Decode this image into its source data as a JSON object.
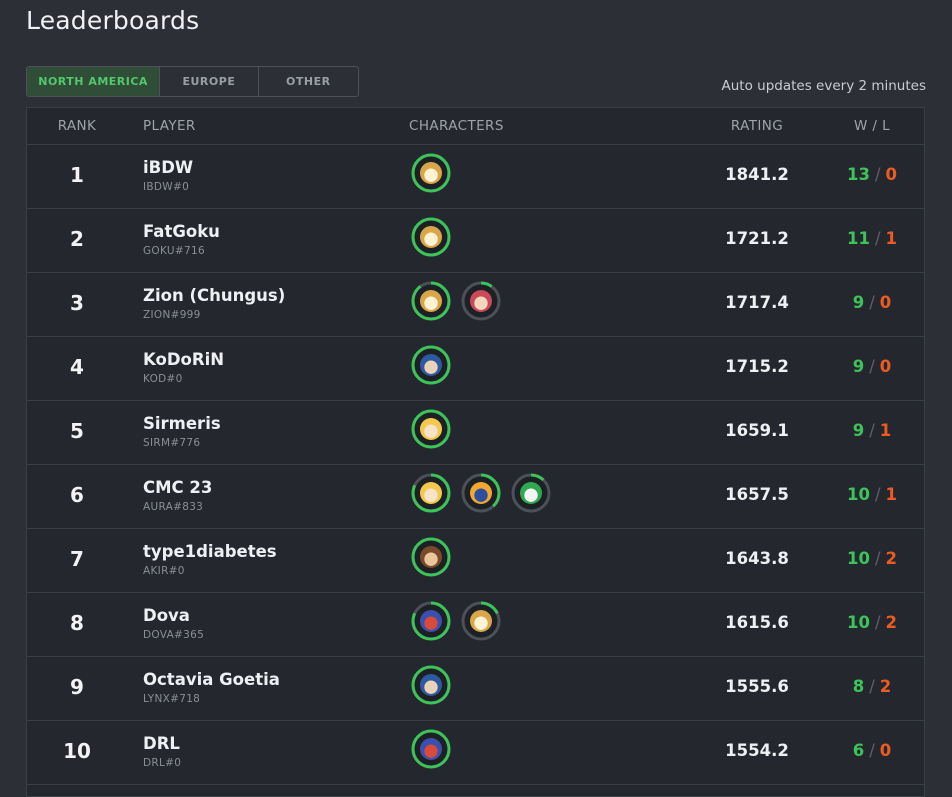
{
  "page": {
    "title": "Leaderboards",
    "auto_update": "Auto updates every 2 minutes"
  },
  "tabs": [
    {
      "label": "NORTH AMERICA",
      "active": true
    },
    {
      "label": "EUROPE",
      "active": false
    },
    {
      "label": "OTHER",
      "active": false
    }
  ],
  "columns": {
    "rank": "RANK",
    "player": "PLAYER",
    "characters": "CHARACTERS",
    "rating": "RATING",
    "wl": "W / L"
  },
  "colors": {
    "win": "#3cc45a",
    "loss": "#ec5b22",
    "accent": "#53c76d"
  },
  "rows": [
    {
      "rank": "1",
      "name": "iBDW",
      "tag": "IBDW#0",
      "rating": "1841.2",
      "wins": "13",
      "losses": "0",
      "characters": [
        {
          "icon": "fox-icon",
          "usage": 1.0
        }
      ]
    },
    {
      "rank": "2",
      "name": "FatGoku",
      "tag": "GOKU#716",
      "rating": "1721.2",
      "wins": "11",
      "losses": "1",
      "characters": [
        {
          "icon": "fox-icon",
          "usage": 1.0
        }
      ]
    },
    {
      "rank": "3",
      "name": "Zion (Chungus)",
      "tag": "ZION#999",
      "rating": "1717.4",
      "wins": "9",
      "losses": "0",
      "characters": [
        {
          "icon": "fox-icon",
          "usage": 0.9
        },
        {
          "icon": "ness-icon",
          "usage": 0.1
        }
      ]
    },
    {
      "rank": "4",
      "name": "KoDoRiN",
      "tag": "KOD#0",
      "rating": "1715.2",
      "wins": "9",
      "losses": "0",
      "characters": [
        {
          "icon": "marth-icon",
          "usage": 1.0
        }
      ]
    },
    {
      "rank": "5",
      "name": "Sirmeris",
      "tag": "SIRM#776",
      "rating": "1659.1",
      "wins": "9",
      "losses": "1",
      "characters": [
        {
          "icon": "peach-icon",
          "usage": 1.0
        }
      ]
    },
    {
      "rank": "6",
      "name": "CMC 23",
      "tag": "AURA#833",
      "rating": "1657.5",
      "wins": "10",
      "losses": "1",
      "characters": [
        {
          "icon": "peach-icon",
          "usage": 0.82
        },
        {
          "icon": "ice-climbers-icon",
          "usage": 0.38
        },
        {
          "icon": "yoshi-icon",
          "usage": 0.12
        }
      ]
    },
    {
      "rank": "7",
      "name": "type1diabetes",
      "tag": "AKIR#0",
      "rating": "1643.8",
      "wins": "10",
      "losses": "2",
      "characters": [
        {
          "icon": "donkey-kong-icon",
          "usage": 1.0
        }
      ]
    },
    {
      "rank": "8",
      "name": "Dova",
      "tag": "DOVA#365",
      "rating": "1615.6",
      "wins": "10",
      "losses": "2",
      "characters": [
        {
          "icon": "falco-icon",
          "usage": 0.82
        },
        {
          "icon": "fox-icon",
          "usage": 0.18
        }
      ]
    },
    {
      "rank": "9",
      "name": "Octavia Goetia",
      "tag": "LYNX#718",
      "rating": "1555.6",
      "wins": "8",
      "losses": "2",
      "characters": [
        {
          "icon": "marth-icon",
          "usage": 1.0
        }
      ]
    },
    {
      "rank": "10",
      "name": "DRL",
      "tag": "DRL#0",
      "rating": "1554.2",
      "wins": "6",
      "losses": "0",
      "characters": [
        {
          "icon": "falco-icon",
          "usage": 1.0
        }
      ]
    }
  ]
}
